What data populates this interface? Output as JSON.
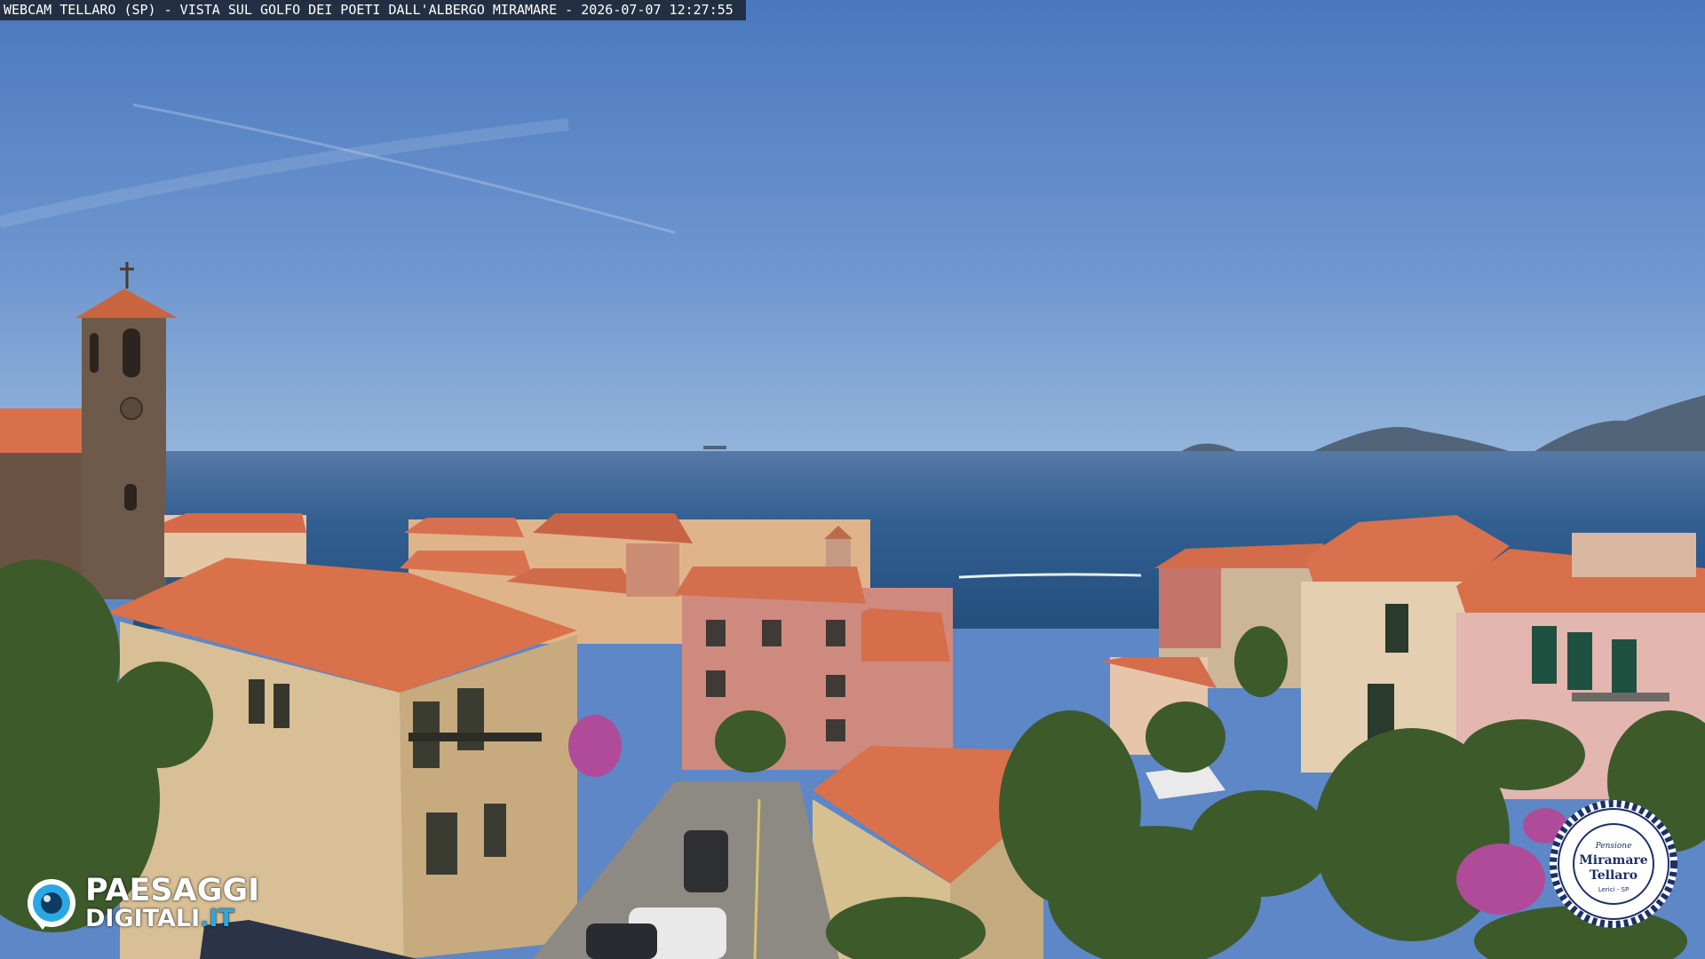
{
  "caption": {
    "text": "WEBCAM TELLARO (SP) - VISTA SUL GOLFO DEI POETI DALL'ALBERGO MIRAMARE - 2026-07-07 12:27:55"
  },
  "brand": {
    "line1": "PAESAGGI",
    "line2_name": "DIGITALI",
    "line2_domain": ".IT",
    "icon": "lens-icon",
    "colors": {
      "text": "#ffffff",
      "accent": "#2ba7e6"
    }
  },
  "badge": {
    "small": "Pensione",
    "name_line1": "Miramare",
    "name_line2": "Tellaro",
    "sub": "Lerici - SP",
    "colors": {
      "ring": "#1c2f66",
      "face": "#ffffff"
    }
  },
  "scene": {
    "colors": {
      "sky_top": "#4f7ec3",
      "sky_horizon": "#8aaed7",
      "sea": "#2f5d8e",
      "roof": "#d9704d",
      "stone": "#6b5344",
      "vegetation": "#3f5a2c"
    }
  }
}
